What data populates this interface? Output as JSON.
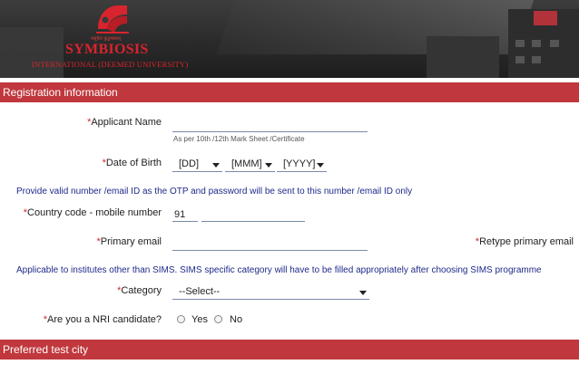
{
  "header": {
    "tagline": "वसुधैव कुटुम्बकम्",
    "name": "SYMBIOSIS",
    "subtitle": "INTERNATIONAL (DEEMED UNIVERSITY)"
  },
  "registration": {
    "title": "Registration information",
    "required_mark": "*",
    "applicant_name": {
      "label": "Applicant Name",
      "value": "",
      "hint": "As per 10th /12th Mark Sheet /Certificate"
    },
    "dob": {
      "label": "Date of Birth",
      "day": "[DD]",
      "month": "[MMM]",
      "year": "[YYYY]"
    },
    "otp_note": "Provide valid number /email ID as the OTP and password will be sent to this number /email ID only",
    "mobile": {
      "label": "Country code - mobile number",
      "country_code": "91",
      "number": ""
    },
    "primary_email": {
      "label": "Primary email",
      "value": ""
    },
    "retype_email": {
      "label": "Retype primary email"
    },
    "category_note": "Applicable to institutes other than SIMS. SIMS specific category will have to be filled appropriately after choosing SIMS programme",
    "category": {
      "label": "Category",
      "selected": "--Select--"
    },
    "nri": {
      "label": "Are you a NRI candidate?",
      "yes": "Yes",
      "no": "No"
    }
  },
  "preferred_city": {
    "title": "Preferred test city"
  },
  "colors": {
    "accent": "#c0383d",
    "brand_red": "#d8242e",
    "note_blue": "#1f2a8a"
  }
}
